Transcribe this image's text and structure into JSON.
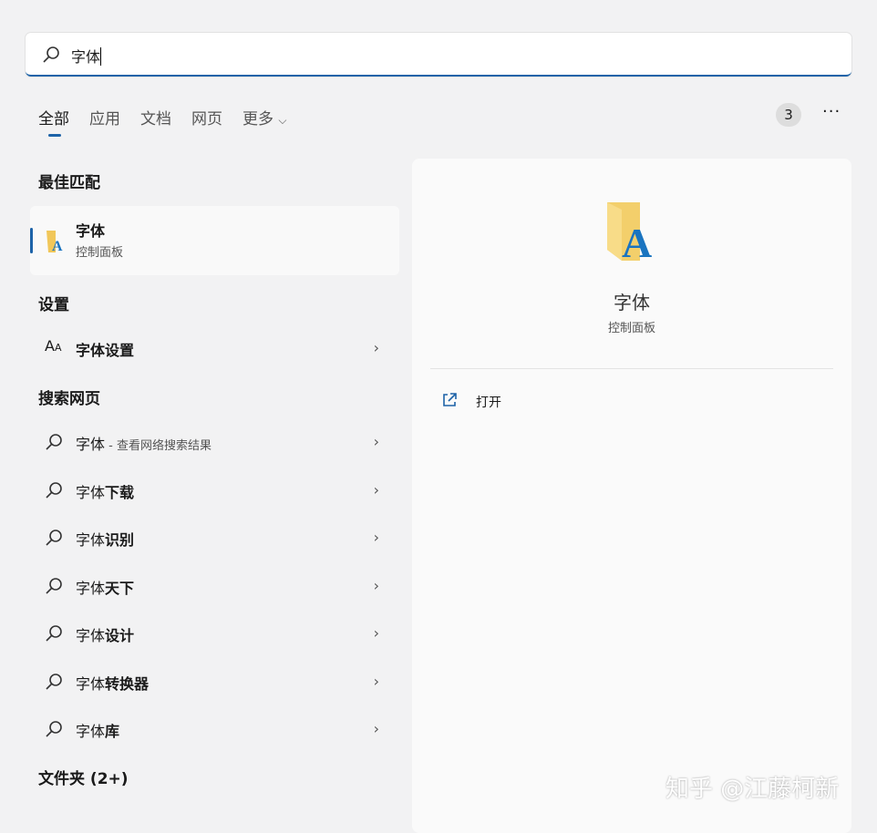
{
  "search": {
    "value": "字体"
  },
  "tabs": [
    "全部",
    "应用",
    "文档",
    "网页",
    "更多"
  ],
  "badge": "3",
  "more_label": "···",
  "best_match": {
    "heading": "最佳匹配",
    "title": "字体",
    "subtitle": "控制面板"
  },
  "settings": {
    "heading": "设置",
    "item_normal": "字体",
    "item_bold": "设置"
  },
  "web": {
    "heading": "搜索网页",
    "items": [
      {
        "normal": "字体",
        "bold": "",
        "suffix": " - 查看网络搜索结果"
      },
      {
        "normal": "字体",
        "bold": "下载",
        "suffix": ""
      },
      {
        "normal": "字体",
        "bold": "识别",
        "suffix": ""
      },
      {
        "normal": "字体",
        "bold": "天下",
        "suffix": ""
      },
      {
        "normal": "字体",
        "bold": "设计",
        "suffix": ""
      },
      {
        "normal": "字体",
        "bold": "转换器",
        "suffix": ""
      },
      {
        "normal": "字体",
        "bold": "库",
        "suffix": ""
      }
    ]
  },
  "folders_heading": "文件夹 (2+)",
  "detail": {
    "title": "字体",
    "subtitle": "控制面板",
    "open_label": "打开"
  },
  "watermark": "知乎 @江藤柯新",
  "colors": {
    "accent": "#1d63a8"
  }
}
